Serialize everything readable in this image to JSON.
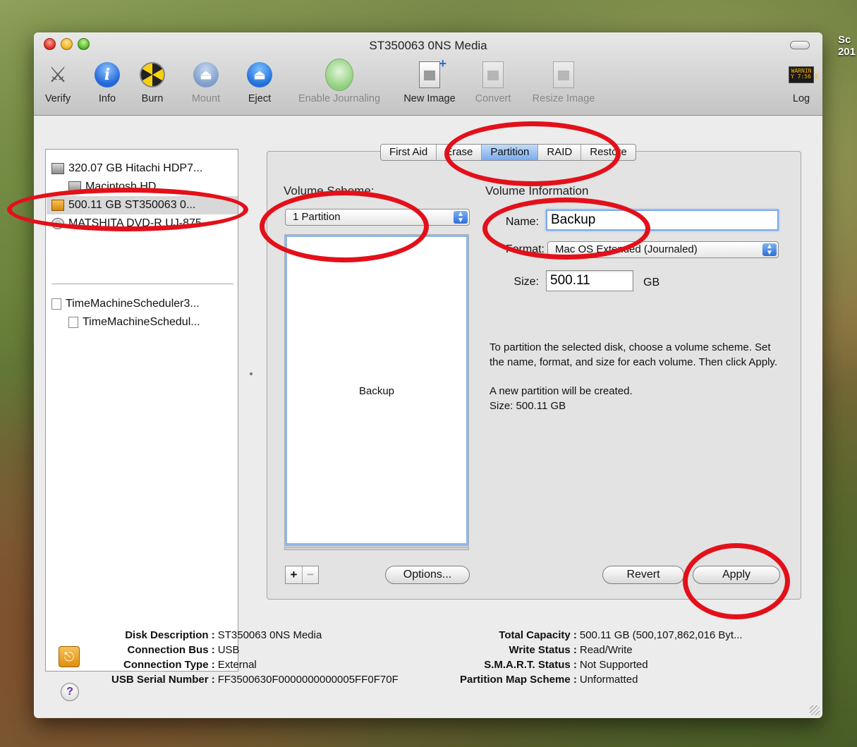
{
  "desktop_text": [
    "Sc",
    "201"
  ],
  "window": {
    "title": "ST350063 0NS Media"
  },
  "toolbar": {
    "verify": "Verify",
    "info": "Info",
    "burn": "Burn",
    "mount": "Mount",
    "eject": "Eject",
    "enable_journaling": "Enable Journaling",
    "new_image": "New Image",
    "convert": "Convert",
    "resize_image": "Resize Image",
    "log": "Log",
    "log_icon_text": "WARNIN\nY 7:56 I"
  },
  "sidebar": {
    "items": [
      {
        "label": "320.07 GB Hitachi HDP7...",
        "icon": "hard-drive-icon"
      },
      {
        "label": "Macintosh HD",
        "icon": "volume-icon"
      },
      {
        "label": "500.11 GB ST350063 0...",
        "icon": "usb-drive-icon"
      },
      {
        "label": "MATSHITA DVD-R UJ-875",
        "icon": "dvd-icon"
      },
      {
        "label": "TimeMachineScheduler3...",
        "icon": "disk-image-icon"
      },
      {
        "label": "TimeMachineSchedul...",
        "icon": "volume-icon"
      }
    ]
  },
  "tabs": [
    "First Aid",
    "Erase",
    "Partition",
    "RAID",
    "Restore"
  ],
  "active_tab": "Partition",
  "partition": {
    "scheme_heading": "Volume Scheme:",
    "scheme_value": "1 Partition",
    "map_label": "Backup",
    "info_heading": "Volume Information",
    "name_label": "Name:",
    "name_value": "Backup",
    "format_label": "Format:",
    "format_value": "Mac OS Extended (Journaled)",
    "size_label": "Size:",
    "size_value": "500.11",
    "size_unit": "GB",
    "help_text": "To partition the selected disk, choose a volume scheme. Set the name, format, and size for each volume. Then click Apply.",
    "status_line1": "A new partition will be created.",
    "status_line2": "Size: 500.11 GB",
    "plus": "+",
    "minus": "−",
    "options_button": "Options...",
    "revert_button": "Revert",
    "apply_button": "Apply"
  },
  "disk_info": {
    "left": [
      {
        "key": "Disk Description :",
        "value": "ST350063 0NS Media"
      },
      {
        "key": "Connection Bus :",
        "value": "USB"
      },
      {
        "key": "Connection Type :",
        "value": "External"
      },
      {
        "key": "USB Serial Number :",
        "value": "FF3500630F0000000000005FF0F70F"
      }
    ],
    "right": [
      {
        "key": "Total Capacity :",
        "value": "500.11 GB (500,107,862,016 Byt..."
      },
      {
        "key": "Write Status :",
        "value": "Read/Write"
      },
      {
        "key": "S.M.A.R.T. Status :",
        "value": "Not Supported"
      },
      {
        "key": "Partition Map Scheme :",
        "value": "Unformatted"
      }
    ]
  },
  "colors": {
    "annotation": "#e3101a",
    "active_tab": "#79aaf0"
  }
}
